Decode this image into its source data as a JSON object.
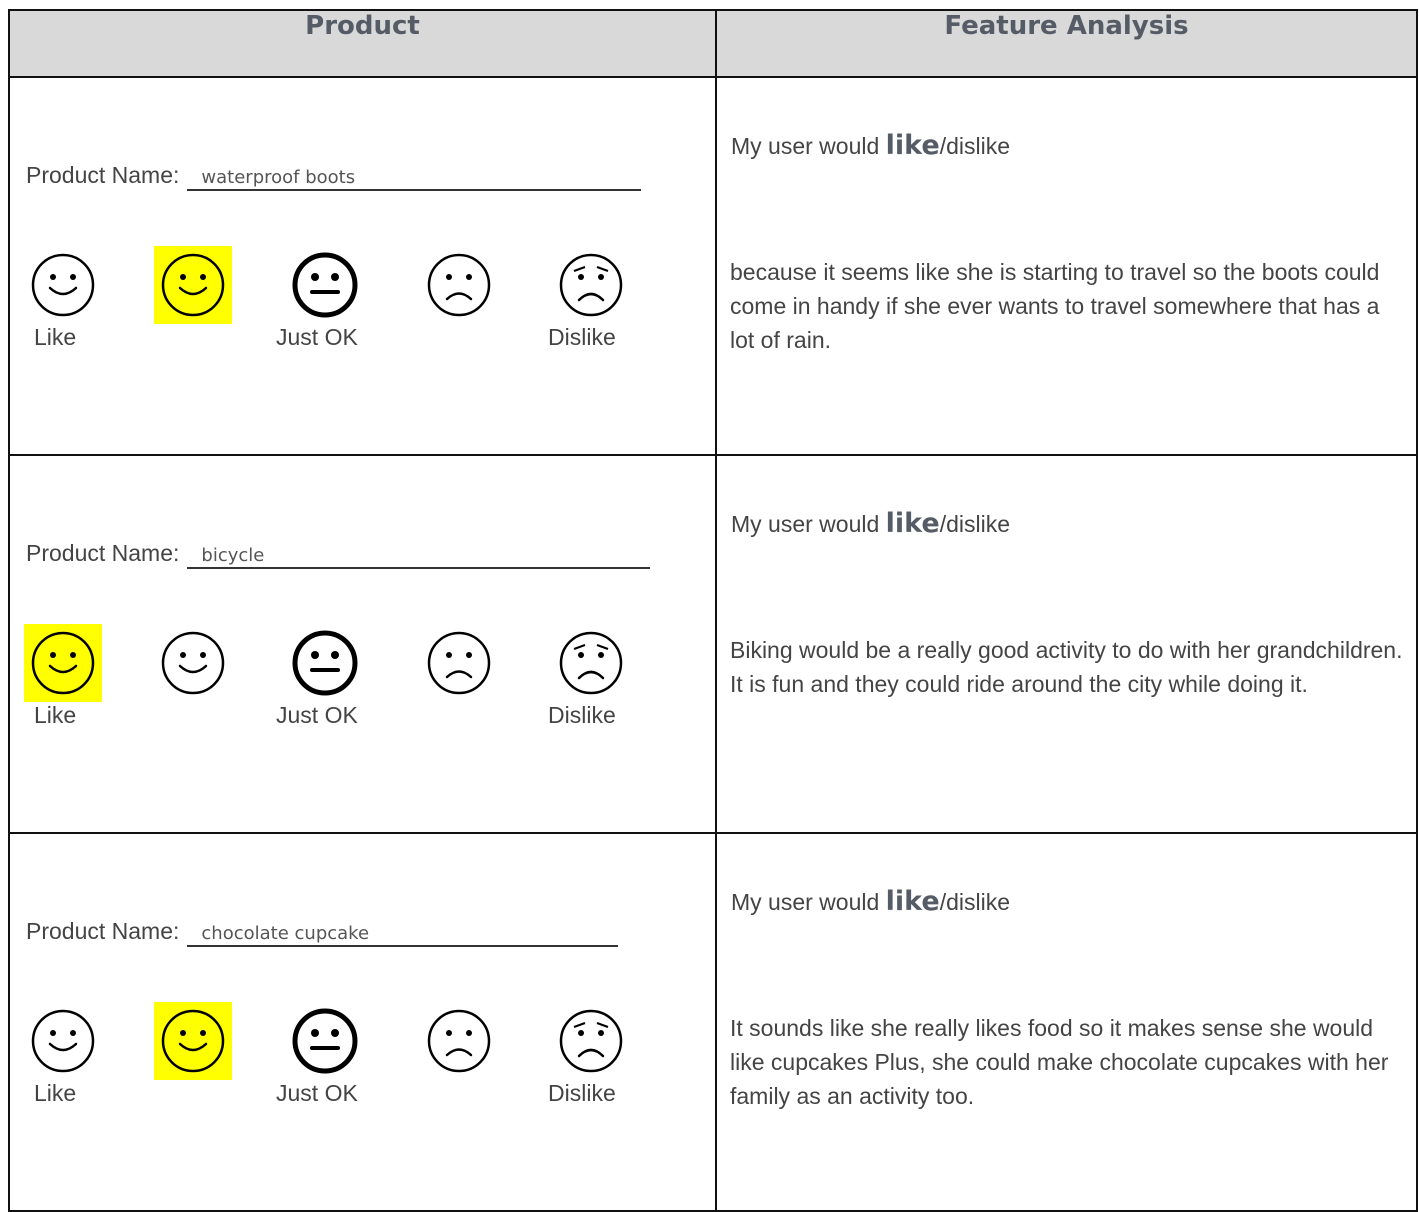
{
  "header": {
    "product": "Product",
    "analysis": "Feature Analysis"
  },
  "rating_labels": {
    "like": "Like",
    "ok": "Just OK",
    "dislike": "Dislike"
  },
  "rows": [
    {
      "product_label": "Product Name:",
      "product_value": "waterproof boots",
      "selected_face_index": 1,
      "verdict_prefix": "My user would ",
      "verdict_emph": "like",
      "verdict_suffix": "/dislike",
      "reason": "because it seems like she is starting to travel so the boots could come in handy if she ever wants to travel somewhere that has a lot of rain."
    },
    {
      "product_label": "Product Name:",
      "product_value": "bicycle",
      "selected_face_index": 0,
      "verdict_prefix": "My user would ",
      "verdict_emph": "like",
      "verdict_suffix": "/dislike",
      "reason": "Biking would be a really good activity to do with her grandchildren. It is fun and they could ride around the city while doing it."
    },
    {
      "product_label": "Product Name:",
      "product_value": "chocolate cupcake",
      "selected_face_index": 1,
      "verdict_prefix": "My user would ",
      "verdict_emph": "like",
      "verdict_suffix": "/dislike",
      "reason": "It sounds like she really likes food so it makes sense she would like cupcakes Plus, she could make chocolate cupcakes with her family as an activity too."
    }
  ],
  "colors": {
    "highlight": "#ffff00",
    "header_bg": "#d9d9d9"
  }
}
